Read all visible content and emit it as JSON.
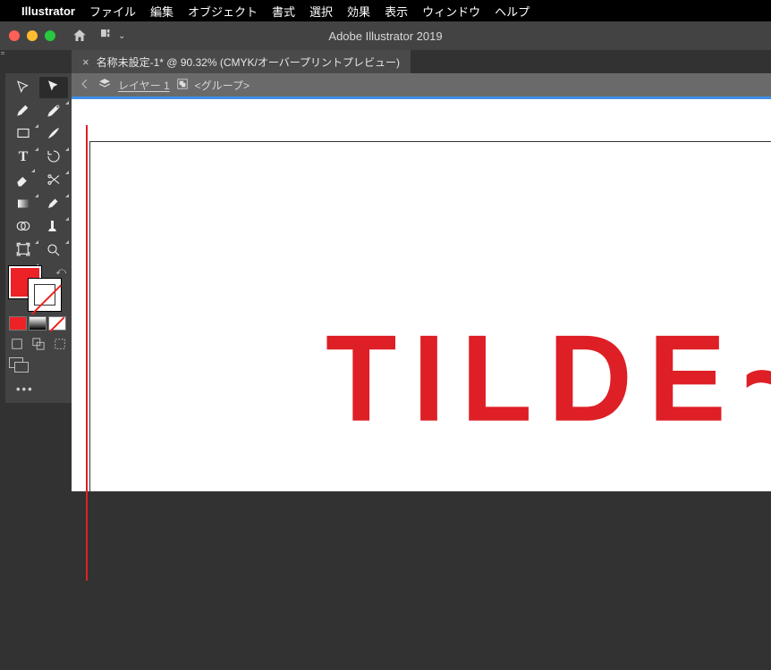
{
  "menubar": {
    "appname": "Illustrator",
    "items": [
      "ファイル",
      "編集",
      "オブジェクト",
      "書式",
      "選択",
      "効果",
      "表示",
      "ウィンドウ",
      "ヘルプ"
    ]
  },
  "titlebar": {
    "title": "Adobe Illustrator 2019"
  },
  "doc_tab": {
    "close": "×",
    "label": "名称未設定-1* @ 90.32% (CMYK/オーバープリントプレビュー)"
  },
  "breadcrumb": {
    "layer": "レイヤー  1",
    "group": "<グループ>"
  },
  "canvas": {
    "text": "TILDE~"
  },
  "colors": {
    "fill": "#ec2227"
  }
}
